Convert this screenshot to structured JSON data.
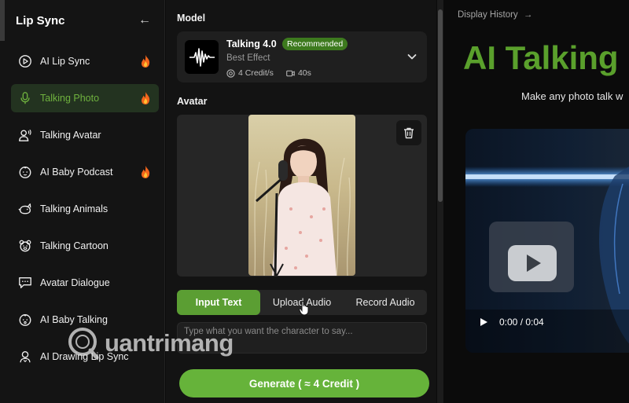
{
  "sidebar": {
    "title": "Lip Sync",
    "back_icon": "←",
    "items": [
      {
        "label": "AI Lip Sync",
        "icon": "play-circle-icon",
        "hot": true,
        "active": false
      },
      {
        "label": "Talking Photo",
        "icon": "microphone-icon",
        "hot": true,
        "active": true
      },
      {
        "label": "Talking Avatar",
        "icon": "person-speaking-icon",
        "hot": false,
        "active": false
      },
      {
        "label": "AI Baby Podcast",
        "icon": "baby-face-icon",
        "hot": true,
        "active": false
      },
      {
        "label": "Talking Animals",
        "icon": "animal-icon",
        "hot": false,
        "active": false
      },
      {
        "label": "Talking Cartoon",
        "icon": "cartoon-bear-icon",
        "hot": false,
        "active": false
      },
      {
        "label": "Avatar Dialogue",
        "icon": "dialogue-icon",
        "hot": false,
        "active": false
      },
      {
        "label": "AI Baby Talking",
        "icon": "baby-icon",
        "hot": false,
        "active": false
      },
      {
        "label": "AI Drawing Lip Sync",
        "icon": "drawing-person-icon",
        "hot": false,
        "active": false
      }
    ]
  },
  "model": {
    "section_label": "Model",
    "name": "Talking 4.0",
    "badge": "Recommended",
    "subtitle": "Best Effect",
    "credits": "4 Credit/s",
    "duration": "40s"
  },
  "avatar": {
    "section_label": "Avatar"
  },
  "tabs": {
    "items": [
      "Input Text",
      "Upload Audio",
      "Record Audio"
    ],
    "active_index": 0
  },
  "text_input": {
    "placeholder": "Type what you want the character to say..."
  },
  "generate_button": {
    "label": "Generate ( ≈ 4 Credit )"
  },
  "watermark": {
    "text": "uantrimang"
  },
  "right": {
    "history_link": "Display History",
    "history_arrow": "→",
    "hero_title": "AI Talking P",
    "hero_subtitle": "Make any photo talk w",
    "video_time": "0:00 / 0:04"
  },
  "colors": {
    "accent": "#66b33a",
    "hero_green": "#5aa02c",
    "active_bg": "#233320"
  }
}
